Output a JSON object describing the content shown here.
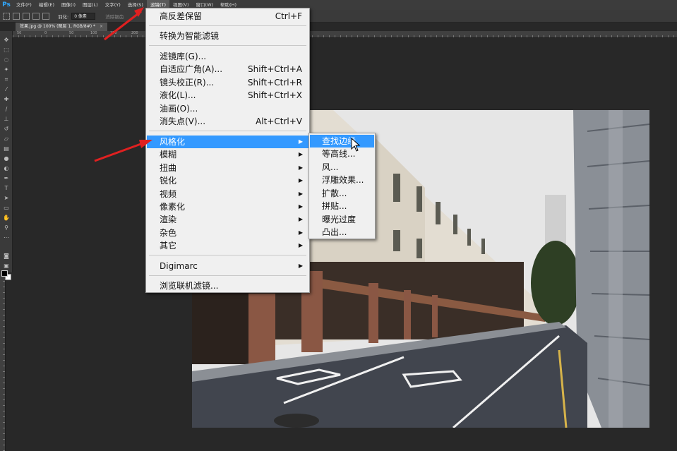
{
  "app": {
    "logo": "Ps"
  },
  "menubar": {
    "items": [
      "文件(F)",
      "编辑(E)",
      "图像(I)",
      "图层(L)",
      "文字(Y)",
      "选择(S)",
      "滤镜(T)",
      "视图(V)",
      "窗口(W)",
      "帮助(H)"
    ],
    "active_index": 6
  },
  "options": {
    "feather_label": "羽化:",
    "feather_value": "0 像素",
    "antialias_label": "消除锯齿"
  },
  "document": {
    "tab_title": "效果.jpg @ 100% (图层 1, RGB/8#) *",
    "close": "×"
  },
  "ruler": {
    "top_labels": [
      "50",
      "0",
      "50",
      "100",
      "150",
      "200",
      "250"
    ]
  },
  "filter_menu": {
    "last_filter": {
      "label": "高反差保留",
      "shortcut": "Ctrl+F"
    },
    "smart": "转换为智能滤镜",
    "group1": [
      {
        "label": "滤镜库(G)...",
        "shortcut": ""
      },
      {
        "label": "自适应广角(A)...",
        "shortcut": "Shift+Ctrl+A"
      },
      {
        "label": "镜头校正(R)...",
        "shortcut": "Shift+Ctrl+R"
      },
      {
        "label": "液化(L)...",
        "shortcut": "Shift+Ctrl+X"
      },
      {
        "label": "油画(O)...",
        "shortcut": ""
      },
      {
        "label": "消失点(V)...",
        "shortcut": "Alt+Ctrl+V"
      }
    ],
    "group2": [
      "风格化",
      "模糊",
      "扭曲",
      "锐化",
      "视频",
      "像素化",
      "渲染",
      "杂色",
      "其它"
    ],
    "digimarc": "Digimarc",
    "browse": "浏览联机滤镜...",
    "highlight_color": "#3399ff"
  },
  "stylize_submenu": {
    "items": [
      "查找边缘",
      "等高线...",
      "风...",
      "浮雕效果...",
      "扩散...",
      "拼贴...",
      "曝光过度",
      "凸出..."
    ],
    "highlight_index": 0
  },
  "canvas": {
    "image_subject": "street-photo-arcade-buildings"
  },
  "annotation_color": "#e02020"
}
